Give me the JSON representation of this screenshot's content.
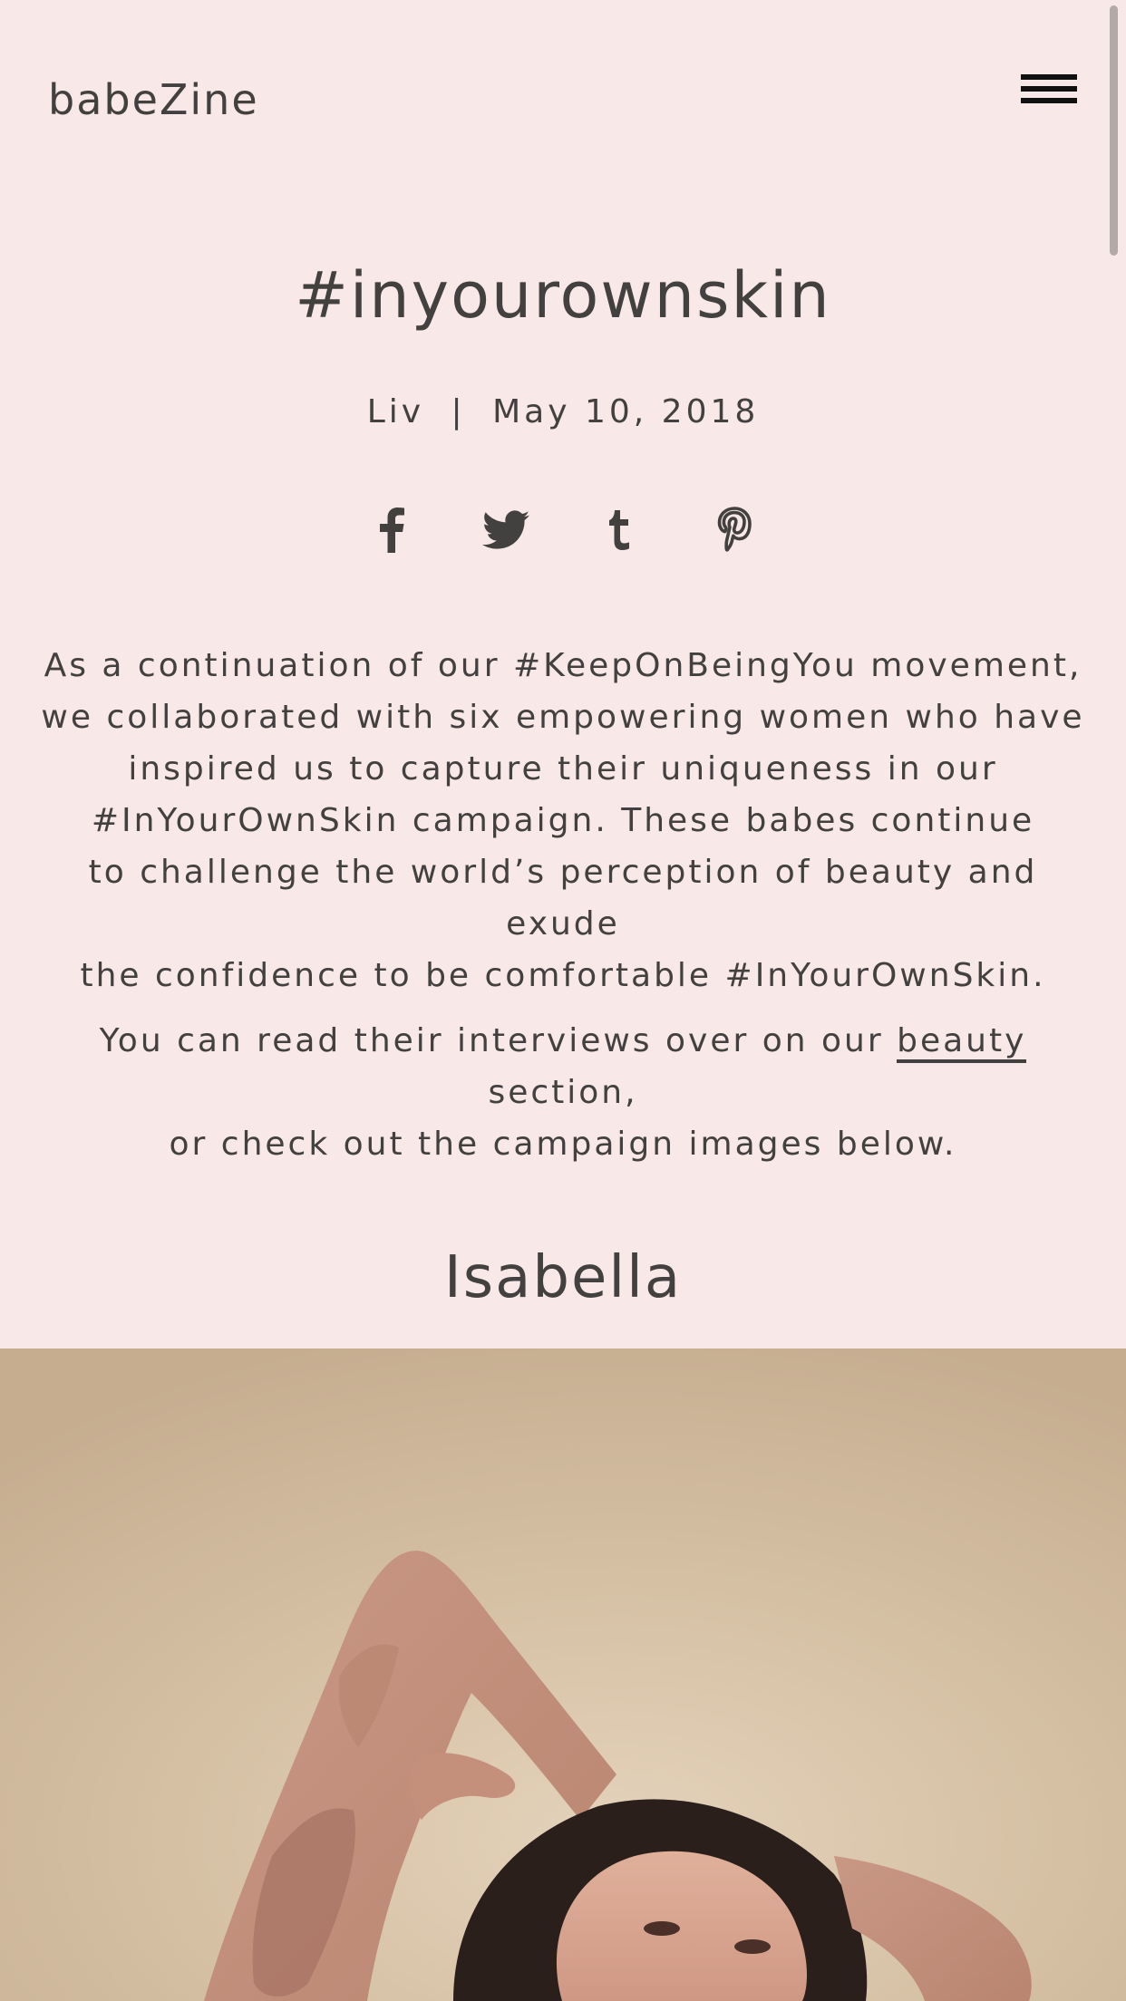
{
  "header": {
    "logo": "babeZine",
    "menu_icon": "hamburger-menu-icon"
  },
  "article": {
    "title": "#inyourownskin",
    "author": "Liv",
    "separator": "|",
    "date": "May 10, 2018",
    "share": [
      {
        "name": "facebook",
        "icon": "facebook-icon"
      },
      {
        "name": "twitter",
        "icon": "twitter-icon"
      },
      {
        "name": "tumblr",
        "icon": "tumblr-icon"
      },
      {
        "name": "pinterest",
        "icon": "pinterest-icon"
      }
    ],
    "paragraph1_lines": [
      "As a continuation of our #KeepOnBeingYou movement,",
      "we collaborated with six empowering women who have",
      "inspired us to capture their uniqueness in our",
      "#InYourOwnSkin campaign. These babes continue",
      "to challenge the world’s perception of beauty and exude",
      "the confidence to be comfortable #InYourOwnSkin."
    ],
    "paragraph2_before_link": "You can read their interviews over on our ",
    "paragraph2_link": "beauty",
    "paragraph2_after_link": " section,",
    "paragraph2_line2": "or check out the campaign images below."
  },
  "section": {
    "name": "Isabella"
  },
  "colors": {
    "background": "#f8e8e7",
    "text": "#434040",
    "menu": "#111111",
    "photo_backdrop": "#d3bd9f",
    "skin": "#c99a82",
    "hair": "#2b1f1c"
  }
}
